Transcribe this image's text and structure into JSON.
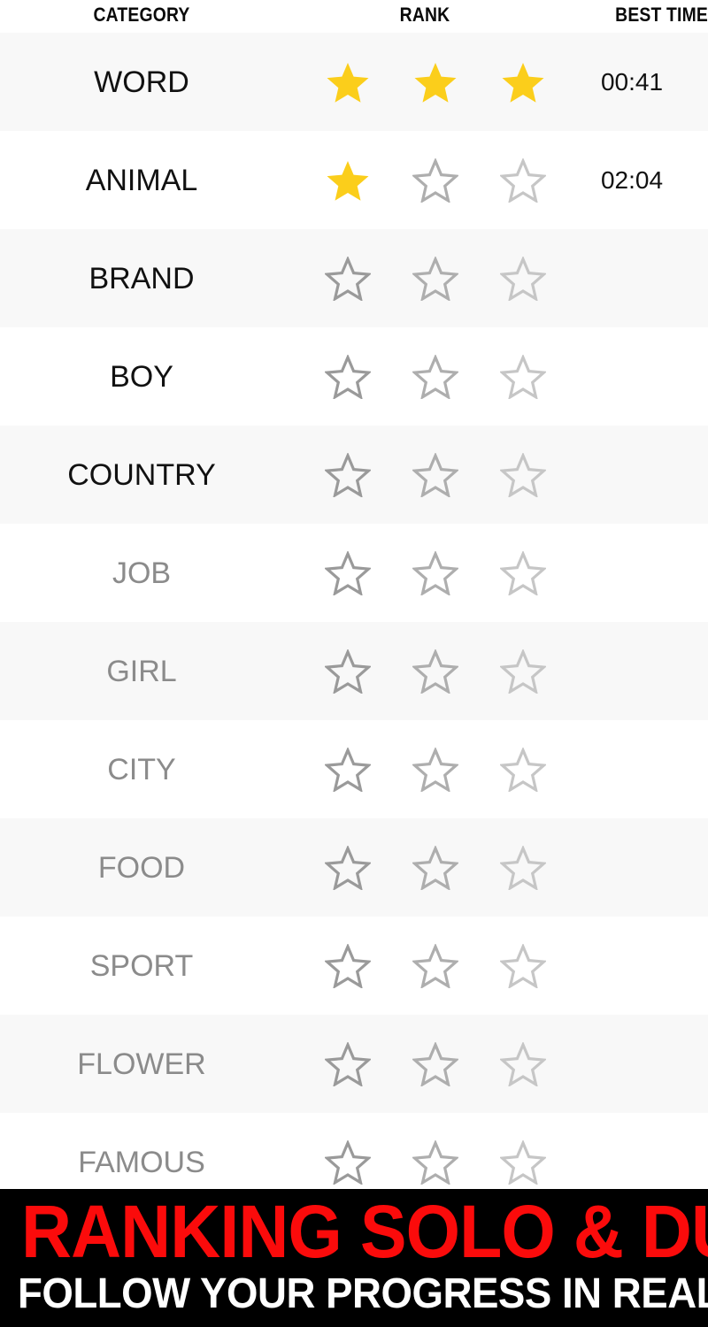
{
  "colors": {
    "star_filled": "#fbce1b",
    "star_empty_1": "#9a9a9a",
    "star_empty_2": "#aeaeae",
    "star_empty_3": "#c6c6c6",
    "row_stripe": "#f8f8f8",
    "row_plain": "#ffffff",
    "text_active": "#111111",
    "text_locked": "#8b8b8b",
    "banner_bg": "#000000",
    "banner_red": "#fb0b0b",
    "banner_white": "#ffffff"
  },
  "header": {
    "category_label": "CATEGORY",
    "rank_label": "RANK",
    "best_time_label": "BEST TIME"
  },
  "rows": [
    {
      "category": "WORD",
      "stars": 3,
      "best_time": "00:41",
      "locked": false
    },
    {
      "category": "ANIMAL",
      "stars": 1,
      "best_time": "02:04",
      "locked": false
    },
    {
      "category": "BRAND",
      "stars": 0,
      "best_time": "",
      "locked": false
    },
    {
      "category": "BOY",
      "stars": 0,
      "best_time": "",
      "locked": false
    },
    {
      "category": "COUNTRY",
      "stars": 0,
      "best_time": "",
      "locked": false
    },
    {
      "category": "JOB",
      "stars": 0,
      "best_time": "",
      "locked": true
    },
    {
      "category": "GIRL",
      "stars": 0,
      "best_time": "",
      "locked": true
    },
    {
      "category": "CITY",
      "stars": 0,
      "best_time": "",
      "locked": true
    },
    {
      "category": "FOOD",
      "stars": 0,
      "best_time": "",
      "locked": true
    },
    {
      "category": "SPORT",
      "stars": 0,
      "best_time": "",
      "locked": true
    },
    {
      "category": "FLOWER",
      "stars": 0,
      "best_time": "",
      "locked": true
    },
    {
      "category": "FAMOUS",
      "stars": 0,
      "best_time": "",
      "locked": true
    }
  ],
  "banner": {
    "line1": "RANKING SOLO & DUO",
    "line2": "FOLLOW YOUR PROGRESS IN REAL TIME"
  },
  "icons": {
    "star_filled": "star-filled-icon",
    "star_empty": "star-outline-icon"
  }
}
